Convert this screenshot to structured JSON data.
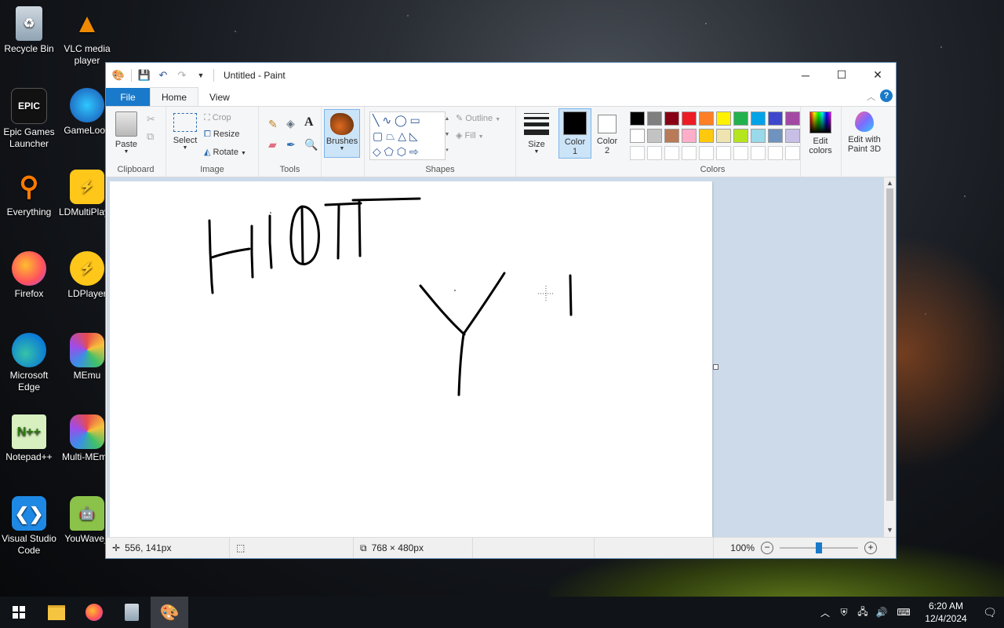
{
  "desktop": {
    "icons": [
      {
        "label": "Recycle Bin",
        "icon": "recycle-bin-icon"
      },
      {
        "label": "VLC media player",
        "icon": "vlc-icon"
      },
      {
        "label": "Epic Games Launcher",
        "icon": "epic-games-icon"
      },
      {
        "label": "GameLoop",
        "icon": "gameloop-icon"
      },
      {
        "label": "Everything",
        "icon": "everything-search-icon"
      },
      {
        "label": "LDMultiPlayer",
        "icon": "ldmultiplayer-icon"
      },
      {
        "label": "Firefox",
        "icon": "firefox-icon"
      },
      {
        "label": "LDPlayer",
        "icon": "ldplayer-icon"
      },
      {
        "label": "Microsoft Edge",
        "icon": "edge-icon"
      },
      {
        "label": "MEmu",
        "icon": "memu-icon"
      },
      {
        "label": "Notepad++",
        "icon": "notepadpp-icon"
      },
      {
        "label": "Multi-MEmu",
        "icon": "multi-memu-icon"
      },
      {
        "label": "Visual Studio Code",
        "icon": "vscode-icon"
      },
      {
        "label": "YouWave_",
        "icon": "youwave-icon"
      }
    ]
  },
  "window": {
    "title": "Untitled - Paint",
    "controls": {
      "minimize": "─",
      "maximize": "☐",
      "close": "✕"
    }
  },
  "tabs": {
    "file": "File",
    "home": "Home",
    "view": "View"
  },
  "ribbon": {
    "clipboard": {
      "label": "Clipboard",
      "paste": "Paste"
    },
    "image": {
      "label": "Image",
      "select": "Select",
      "crop": "Crop",
      "resize": "Resize",
      "rotate": "Rotate"
    },
    "tools": {
      "label": "Tools"
    },
    "brushes": {
      "label": "Brushes"
    },
    "shapes": {
      "label": "Shapes",
      "outline": "Outline",
      "fill": "Fill"
    },
    "size": {
      "label": "Size"
    },
    "color1": {
      "label": "Color",
      "num": "1",
      "value": "#000000"
    },
    "color2": {
      "label": "Color",
      "num": "2",
      "value": "#ffffff"
    },
    "colors": {
      "label": "Colors",
      "row1": [
        "#000000",
        "#7f7f7f",
        "#880015",
        "#ed1c24",
        "#ff7f27",
        "#fff200",
        "#22b14c",
        "#00a2e8",
        "#3f48cc",
        "#a349a4"
      ],
      "row2": [
        "#ffffff",
        "#c3c3c3",
        "#b97a57",
        "#ffaec9",
        "#ffc90e",
        "#efe4b0",
        "#b5e61d",
        "#99d9ea",
        "#7092be",
        "#c8bfe7"
      ],
      "row3": [
        "#ffffff",
        "#ffffff",
        "#ffffff",
        "#ffffff",
        "#ffffff",
        "#ffffff",
        "#ffffff",
        "#ffffff",
        "#ffffff",
        "#ffffff"
      ]
    },
    "edit_colors": {
      "line1": "Edit",
      "line2": "colors"
    },
    "paint3d": {
      "line1": "Edit with",
      "line2": "Paint 3D"
    }
  },
  "status": {
    "cursor_pos": "556, 141px",
    "canvas_size": "768 × 480px",
    "zoom": "100%",
    "zoom_level": 0.5
  },
  "taskbar": {
    "items": [
      "start-icon",
      "file-explorer-icon",
      "firefox-icon",
      "recycle-bin-icon",
      "paint-icon"
    ],
    "time": "6:20 AM",
    "date": "12/4/2024"
  }
}
